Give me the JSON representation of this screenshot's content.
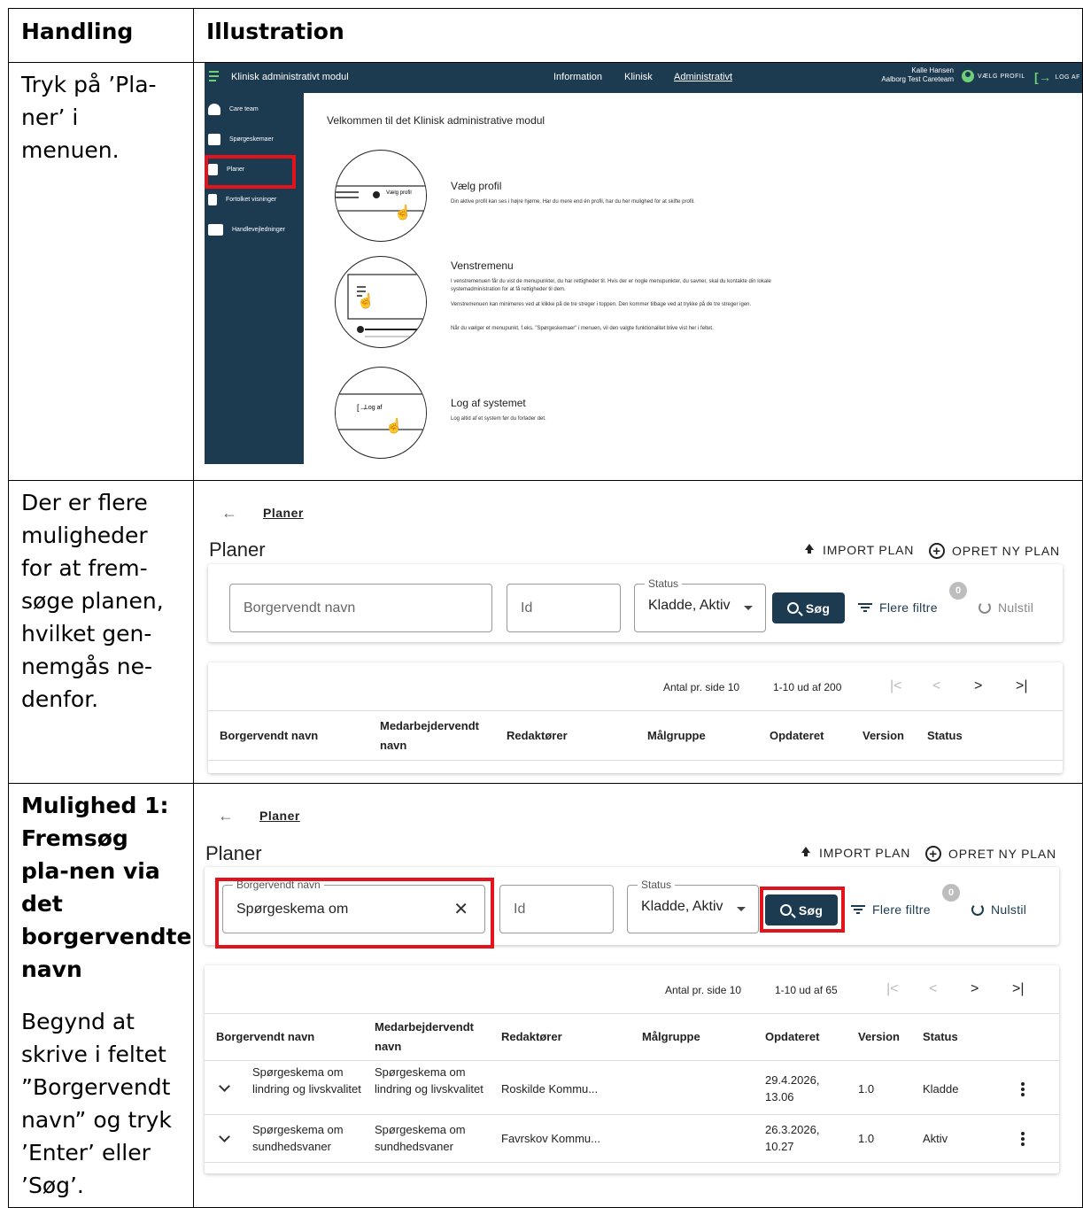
{
  "table": {
    "col1_header": "Handling",
    "col2_header": "Illustration"
  },
  "rows": [
    {
      "left_text": "Tryk på ’Pla-ner’ i menuen."
    },
    {
      "left_text": "Der er flere muligheder for at frem-søge planen, hvilket gen-nemgås ne-denfor."
    },
    {
      "left_bold": "Mulighed 1: Fremsøg pla-nen via det borgervendte navn",
      "left_text": "Begynd at skrive i feltet ”Borgervendt navn” og tryk ’Enter’ eller ’Søg’."
    }
  ],
  "app": {
    "title": "Klinisk administrativt modul",
    "nav": [
      "Information",
      "Klinisk",
      "Administrativt"
    ],
    "user_name": "Kalle Hansen",
    "user_team": "Aalborg Test Careteam",
    "profile_label": "VÆLG PROFIL",
    "logout_label": "LOG AF",
    "sidebar": [
      "Care team",
      "Spørgeskemaer",
      "Planer",
      "Fortolket visninger",
      "Handlevejledninger"
    ],
    "welcome": "Velkommen til det Klinisk administrative modul",
    "sections": [
      {
        "title": "Vælg profil",
        "text": "Din aktive profil kan ses i højre hjørne. Har du mere end én profil, har du her mulighed for at skifte profil.",
        "illus_label": "Vælg profil"
      },
      {
        "title": "Venstremenu",
        "text1": "I venstremenuen får du vist de menupunkter, du har rettigheder til. Hvis der er nogle menupunkter, du savner, skal du kontakte din lokale systemadministration for at få rettigheder til dem.",
        "text2": "Venstremenuen kan minimeres ved at klikke på de tre streger i toppen. Den kommer tilbage ved at trykke på de tre streger igen.",
        "text3": "Når du vælger et menupunkt, f.eks. \"Spørgeskemaer\" i menuen, vil den valgte funktionalitet blive vist her i feltet."
      },
      {
        "title": "Log af systemet",
        "text": "Log altid af et system før du forlader det.",
        "illus_label": "Log af"
      }
    ]
  },
  "planer": {
    "breadcrumb": "Planer",
    "title": "Planer",
    "import_label": "IMPORT PLAN",
    "create_label": "OPRET NY PLAN",
    "name_placeholder": "Borgervendt navn",
    "name_label": "Borgervendt navn",
    "id_placeholder": "Id",
    "status_label": "Status",
    "status_value": "Kladde, Aktiv",
    "search_label": "Søg",
    "more_filters_label": "Flere filtre",
    "filter_count": "0",
    "reset_label": "Nulstil",
    "per_page_label": "Antal pr. side 10",
    "columns": [
      "Borgervendt navn",
      "Medarbejdervendt navn",
      "Redaktører",
      "Målgruppe",
      "Opdateret",
      "Version",
      "Status"
    ]
  },
  "screen2": {
    "range": "1-10 ud af 200"
  },
  "screen3": {
    "search_value": "Spørgeskema om",
    "range": "1-10 ud af 65",
    "rows": [
      {
        "citizen": "Spørgeskema om lindring og livskvalitet",
        "staff": "Spørgeskema om lindring og livskvalitet",
        "editor": "Roskilde Kommu...",
        "target": "",
        "updated": "29.4.2026, 13.06",
        "version": "1.0",
        "status": "Kladde"
      },
      {
        "citizen": "Spørgeskema om sundhedsvaner",
        "staff": "Spørgeskema om sundhedsvaner",
        "editor": "Favrskov Kommu...",
        "target": "",
        "updated": "26.3.2026, 10.27",
        "version": "1.0",
        "status": "Aktiv"
      }
    ]
  }
}
